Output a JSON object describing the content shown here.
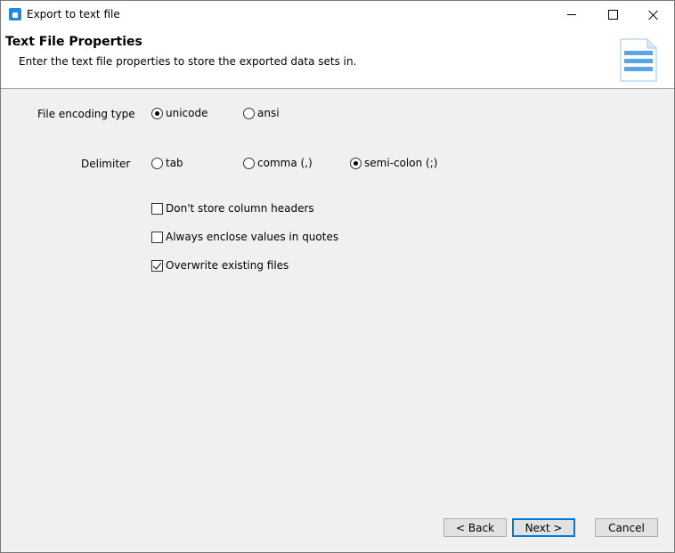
{
  "window": {
    "title": "Export to text file"
  },
  "header": {
    "title": "Text File Properties",
    "description": "Enter the text file properties to store the exported data sets in."
  },
  "encoding": {
    "label": "File encoding type",
    "options": [
      {
        "label": "unicode",
        "checked": true
      },
      {
        "label": "ansi",
        "checked": false
      }
    ]
  },
  "delimiter": {
    "label": "Delimiter",
    "options": [
      {
        "label": "tab",
        "checked": false
      },
      {
        "label": "comma (,)",
        "checked": false
      },
      {
        "label": "semi-colon (;)",
        "checked": true
      }
    ]
  },
  "checkboxes": [
    {
      "label": "Don't store column headers",
      "checked": false
    },
    {
      "label": "Always enclose values in quotes",
      "checked": false
    },
    {
      "label": "Overwrite existing files",
      "checked": true
    }
  ],
  "buttons": {
    "back": "< Back",
    "next": "Next >",
    "cancel": "Cancel"
  },
  "icons": {
    "app": "app-icon",
    "header": "text-document-icon"
  }
}
